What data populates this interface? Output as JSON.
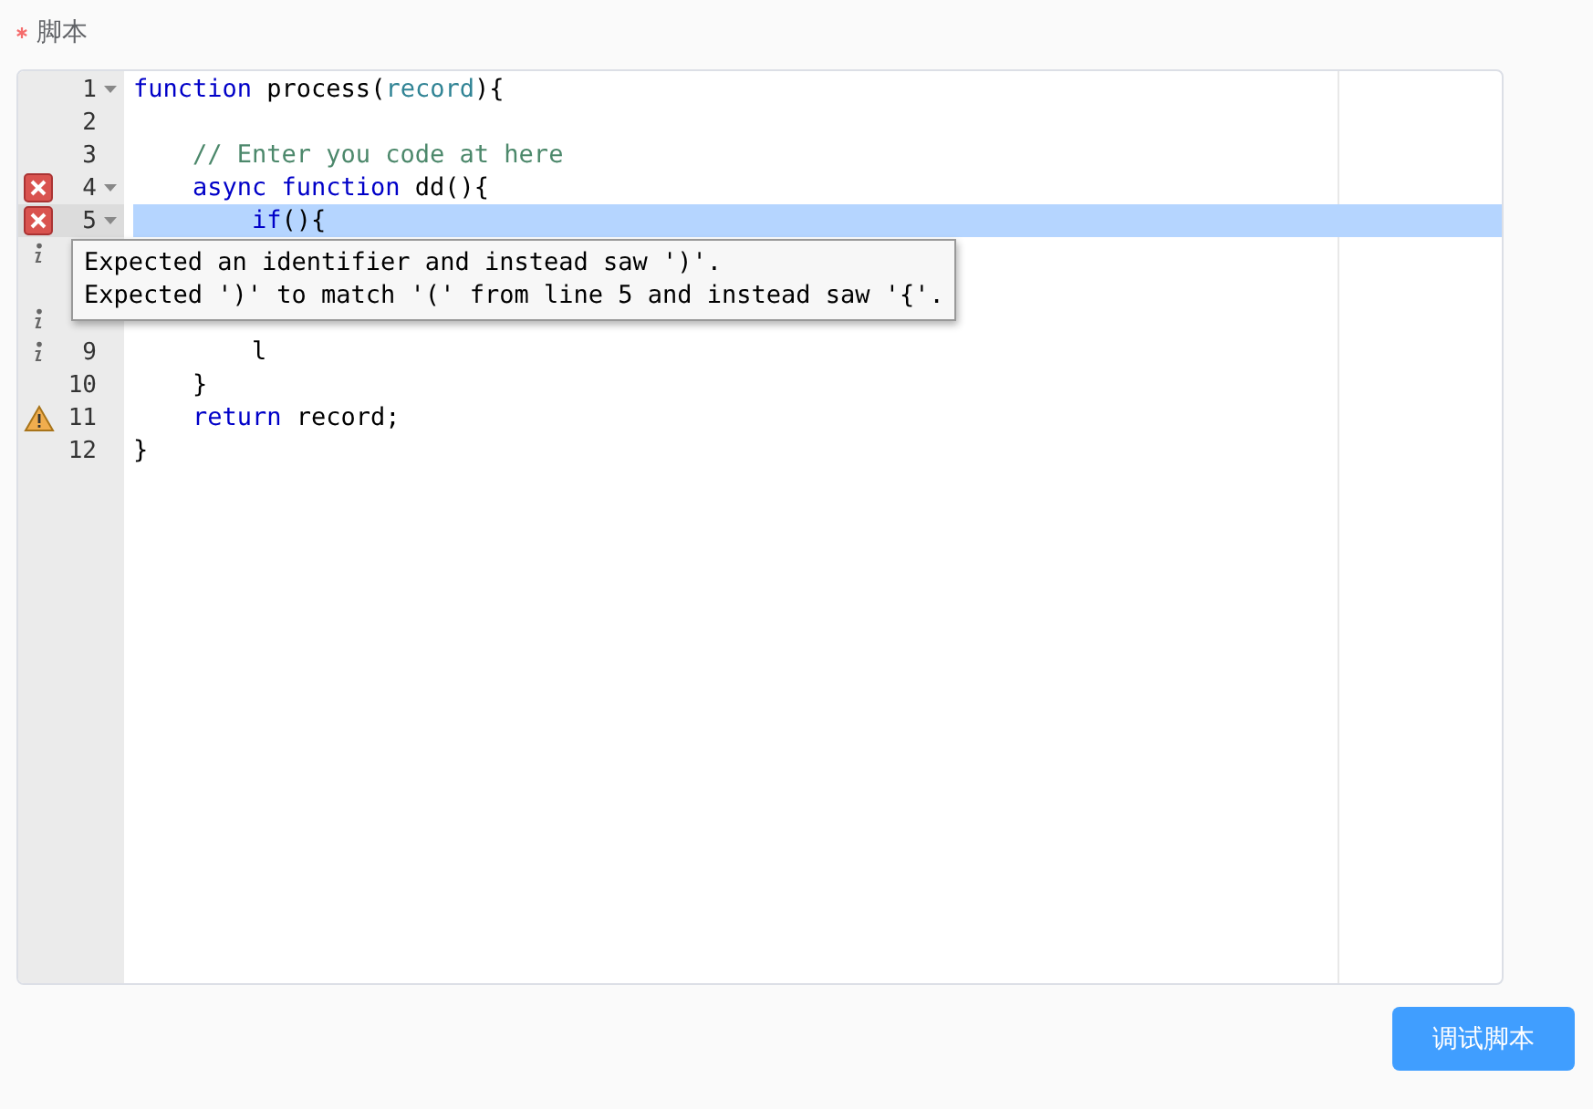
{
  "field": {
    "label": "脚本",
    "required": true
  },
  "editor": {
    "lines": [
      {
        "number": "1",
        "kind": "plain",
        "fold": true,
        "active": false,
        "tokens": [
          {
            "text": "function",
            "kind": "keyword"
          },
          {
            "text": " process",
            "kind": "plain"
          },
          {
            "text": "(",
            "kind": "plain"
          },
          {
            "text": "record",
            "kind": "param"
          },
          {
            "text": "){",
            "kind": "plain"
          }
        ]
      },
      {
        "number": "2",
        "kind": "plain",
        "fold": false,
        "active": false
      },
      {
        "number": "3",
        "kind": "plain",
        "fold": false,
        "active": false,
        "tokens": [
          {
            "text": "    // Enter you code at here",
            "kind": "comment"
          }
        ]
      },
      {
        "number": "4",
        "kind": "error",
        "fold": true,
        "active": false,
        "tokens": [
          {
            "text": "    async function",
            "kind": "keyword"
          },
          {
            "text": " dd(){",
            "kind": "plain"
          }
        ]
      },
      {
        "number": "5",
        "kind": "error",
        "fold": true,
        "active": true,
        "tokens": [
          {
            "text": "        if",
            "kind": "keyword"
          },
          {
            "text": "(){",
            "kind": "plain"
          }
        ]
      },
      {
        "kind": "info",
        "fold": false,
        "active": false
      },
      {
        "kind": "plain"
      },
      {
        "kind": "info",
        "fold": false,
        "active": false
      },
      {
        "number": "9",
        "kind": "info",
        "fold": false,
        "active": false,
        "tokens": [
          {
            "text": "        l",
            "kind": "plain"
          }
        ]
      },
      {
        "number": "10",
        "kind": "plain",
        "fold": false,
        "active": false,
        "tokens": [
          {
            "text": "    }",
            "kind": "plain"
          }
        ]
      },
      {
        "number": "11",
        "kind": "warning",
        "fold": false,
        "active": false,
        "tokens": [
          {
            "text": "    return",
            "kind": "keyword"
          },
          {
            "text": " record;",
            "kind": "plain"
          }
        ]
      },
      {
        "number": "12",
        "kind": "plain",
        "fold": false,
        "active": false,
        "tokens": [
          {
            "text": "}",
            "kind": "plain"
          }
        ]
      }
    ],
    "tooltip": {
      "lines": [
        "Expected an identifier and instead saw ')'.",
        "Expected ')' to match '(' from line 5 and instead saw '{'."
      ]
    }
  },
  "buttons": [
    {
      "label": "调试脚本"
    }
  ]
}
